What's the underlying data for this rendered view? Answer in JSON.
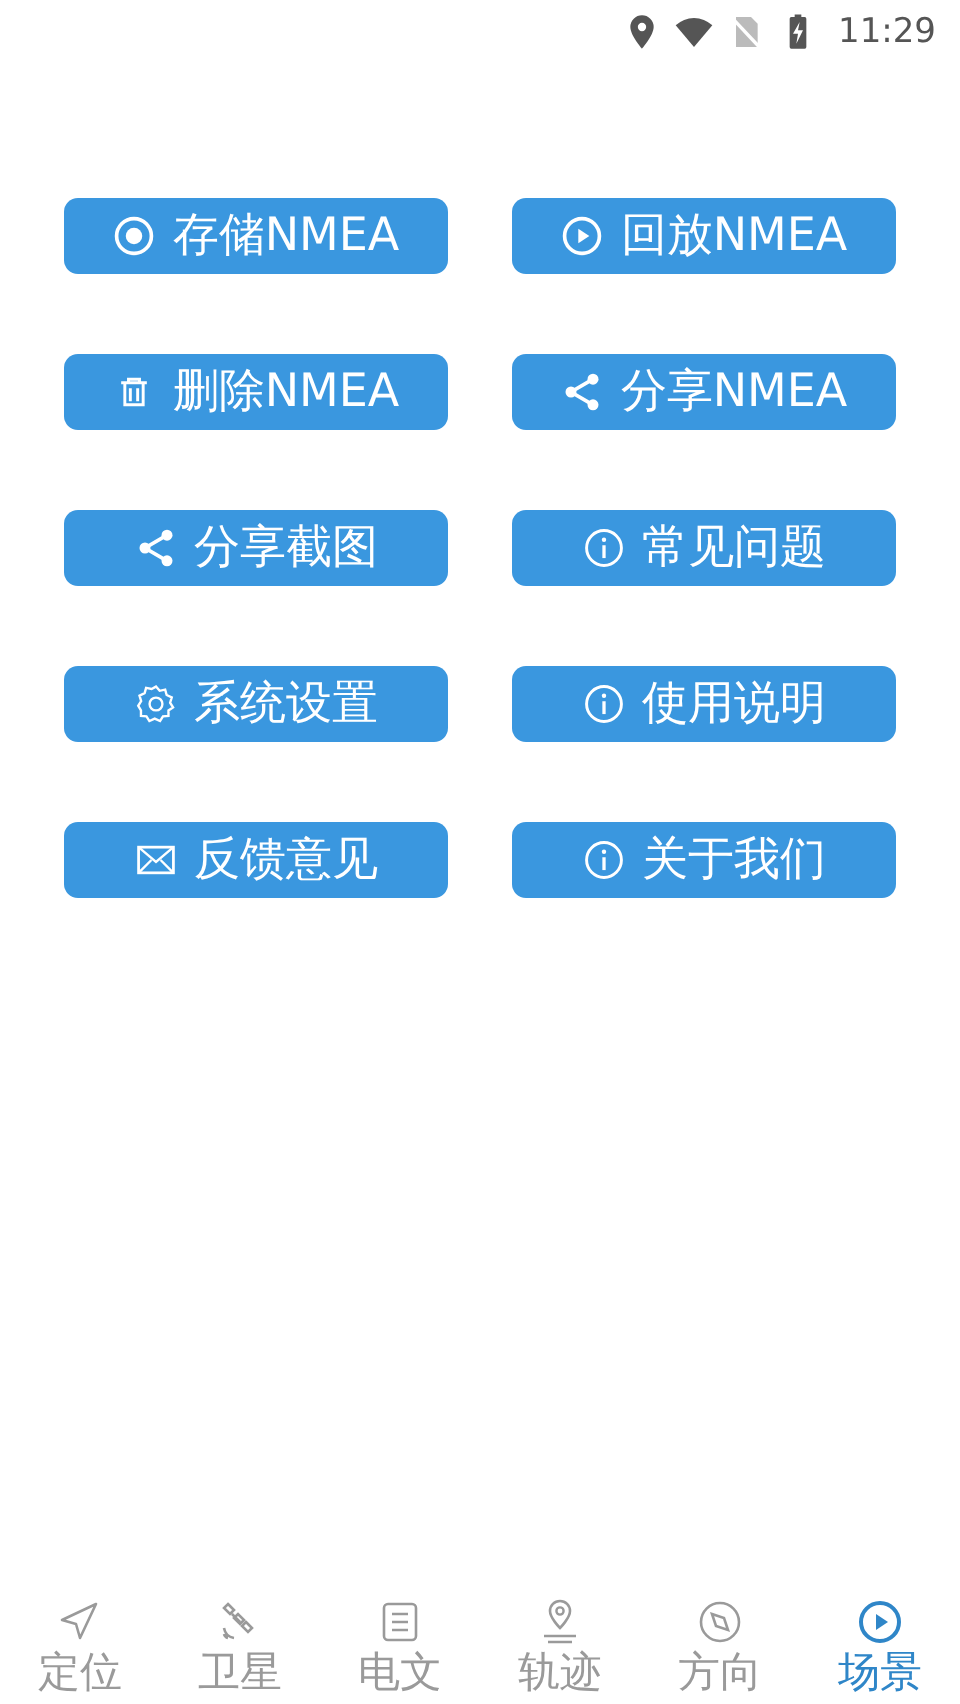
{
  "status_bar": {
    "time": "11:29"
  },
  "menu_buttons": [
    {
      "label": "存储NMEA"
    },
    {
      "label": "回放NMEA"
    },
    {
      "label": "删除NMEA"
    },
    {
      "label": "分享NMEA"
    },
    {
      "label": "分享截图"
    },
    {
      "label": "常见问题"
    },
    {
      "label": "系统设置"
    },
    {
      "label": "使用说明"
    },
    {
      "label": "反馈意见"
    },
    {
      "label": "关于我们"
    }
  ],
  "bottom_nav": [
    {
      "label": "定位",
      "selected": false
    },
    {
      "label": "卫星",
      "selected": false
    },
    {
      "label": "电文",
      "selected": false
    },
    {
      "label": "轨迹",
      "selected": false
    },
    {
      "label": "方向",
      "selected": false
    },
    {
      "label": "场景",
      "selected": true
    }
  ]
}
